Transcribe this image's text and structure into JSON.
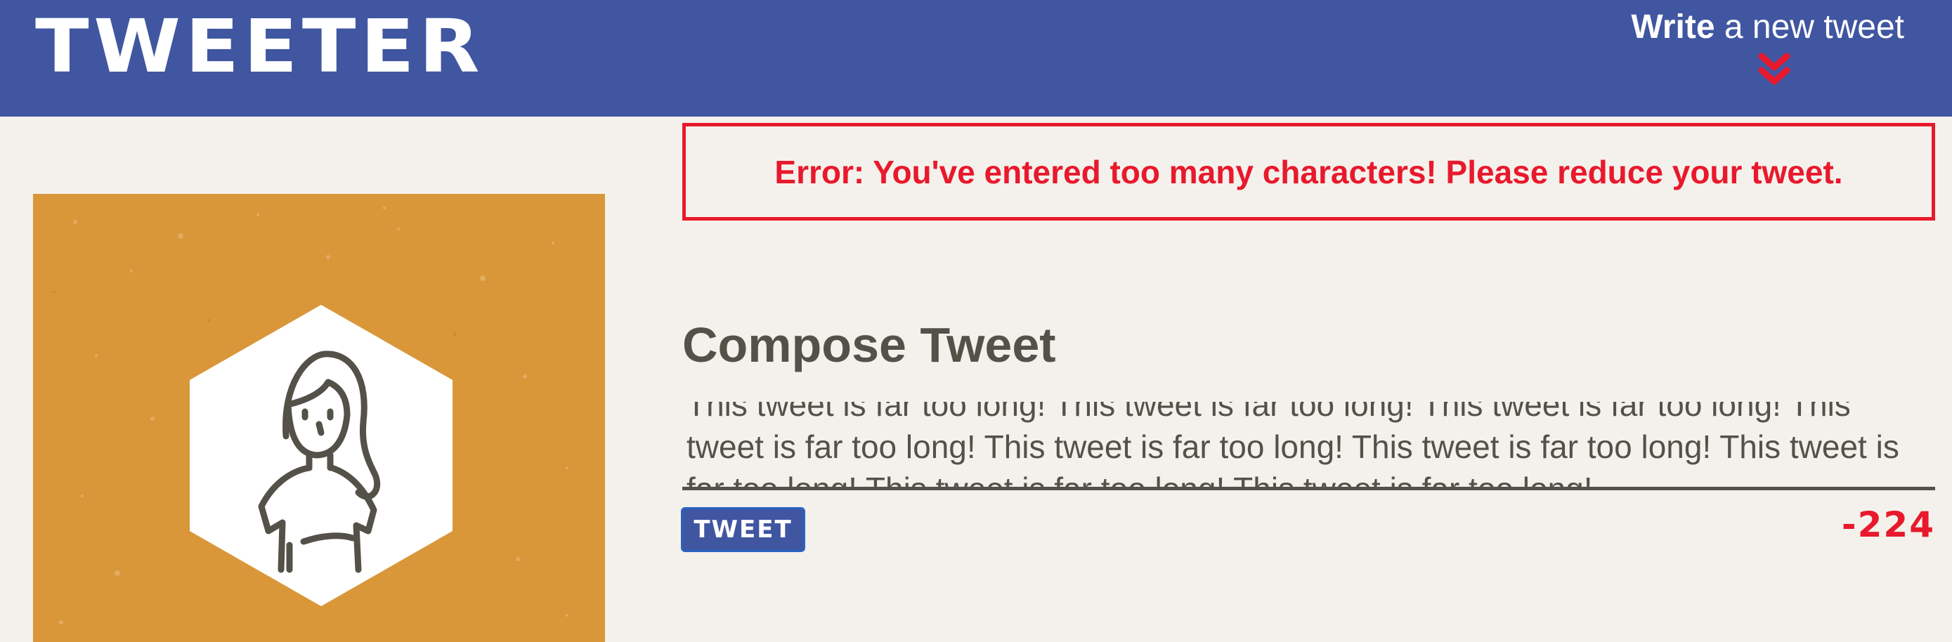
{
  "header": {
    "brand": "TWEETER",
    "write_bold": "Write",
    "write_rest": " a new tweet",
    "chevron_icon": "double-chevron-down",
    "bg_color": "#4056a1",
    "accent_color": "#e8192c"
  },
  "error": {
    "message": "Error: You've entered too many characters! Please reduce your tweet."
  },
  "profile": {
    "avatar_icon": "woman-avatar-hexagon",
    "bg_color": "#d9973a"
  },
  "compose": {
    "title": "Compose Tweet",
    "tweet_value": "This tweet is far too long! This tweet is far too long! This tweet is far too long! This tweet is far too long! This tweet is far too long! This tweet is far too long! This tweet is far too long! This tweet is far too long! This tweet is far too long!",
    "button_label": "TWEET",
    "counter": "-224"
  }
}
